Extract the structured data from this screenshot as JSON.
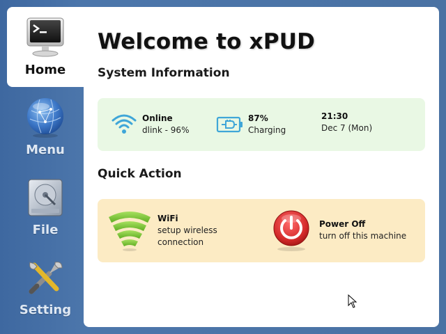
{
  "sidebar": {
    "items": [
      {
        "label": "Home",
        "icon": "terminal-monitor-icon",
        "active": true
      },
      {
        "label": "Menu",
        "icon": "globe-icon",
        "active": false
      },
      {
        "label": "File",
        "icon": "hard-drive-icon",
        "active": false
      },
      {
        "label": "Setting",
        "icon": "tools-icon",
        "active": false
      }
    ]
  },
  "main": {
    "title": "Welcome to xPUD",
    "system_information": {
      "heading": "System Information",
      "network": {
        "status": "Online",
        "detail": "dlink - 96%",
        "icon": "wifi-signal-icon"
      },
      "battery": {
        "status": "87%",
        "detail": "Charging",
        "icon": "battery-charging-icon"
      },
      "clock": {
        "time": "21:30",
        "date": "Dec 7 (Mon)"
      }
    },
    "quick_action": {
      "heading": "Quick Action",
      "wifi": {
        "title": "WiFi",
        "line1": "setup wireless",
        "line2": "connection",
        "icon": "wifi-large-icon"
      },
      "power": {
        "title": "Power Off",
        "detail": "turn off this machine",
        "icon": "power-icon"
      }
    }
  },
  "colors": {
    "background": "#4a72a3",
    "info_box": "#e9f8e4",
    "quick_action_box": "#fcebc4",
    "wifi_green": "#7cc83a",
    "power_red": "#d42a2a",
    "info_icon_blue": "#3fa6d8"
  }
}
